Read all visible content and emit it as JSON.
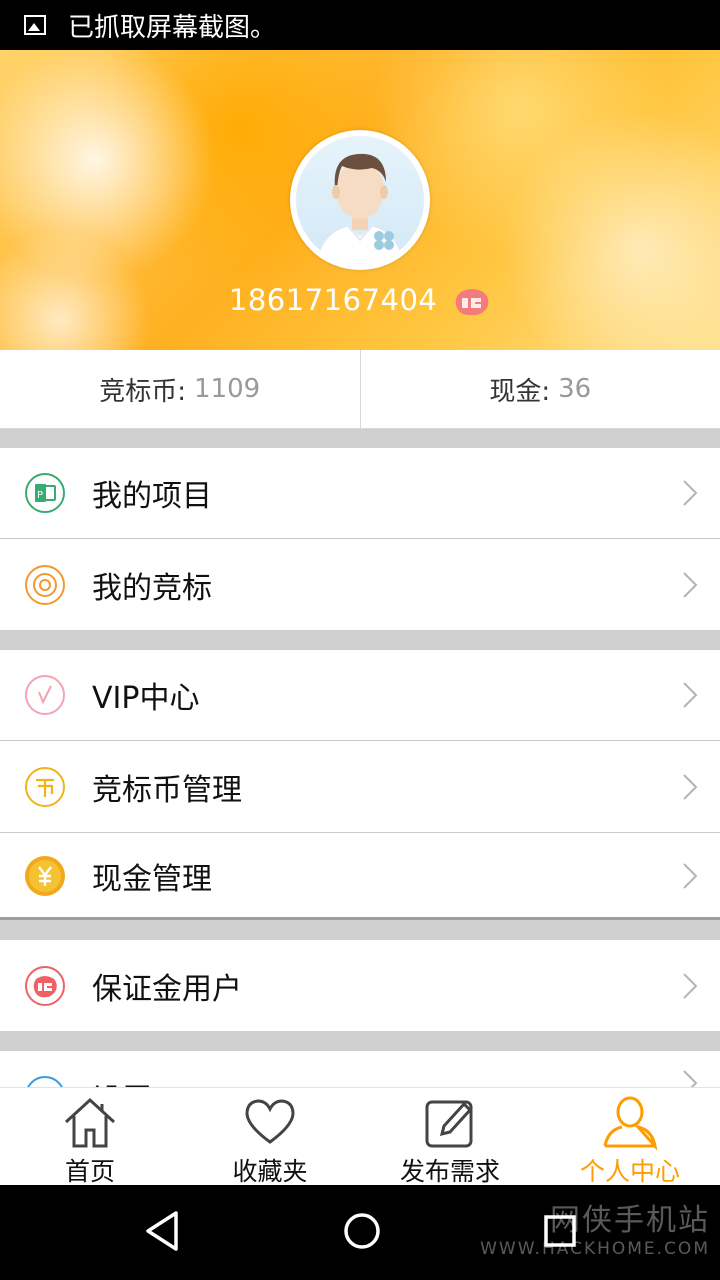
{
  "status_bar": {
    "notification": "已抓取屏幕截图。"
  },
  "profile": {
    "phone": "18617167404"
  },
  "stats": {
    "coin_label": "竞标币:",
    "coin_value": "1109",
    "cash_label": "现金:",
    "cash_value": "36"
  },
  "menu": {
    "my_projects": "我的项目",
    "my_bids": "我的竞标",
    "vip_center": "VIP中心",
    "coin_manage": "竞标币管理",
    "cash_manage": "现金管理",
    "deposit_user": "保证金用户",
    "settings": "设置"
  },
  "tabs": {
    "home": "首页",
    "favorites": "收藏夹",
    "post": "发布需求",
    "profile": "个人中心"
  },
  "colors": {
    "accent": "#ff9c00",
    "green": "#3aaa73",
    "orange": "#f29a2e",
    "pink": "#f4a3b4",
    "gold": "#f1b31c",
    "red": "#f06262",
    "blue": "#3b9be0"
  },
  "watermark": {
    "text1": "网侠手机站",
    "text2": "WWW.HACKHOME.COM"
  }
}
